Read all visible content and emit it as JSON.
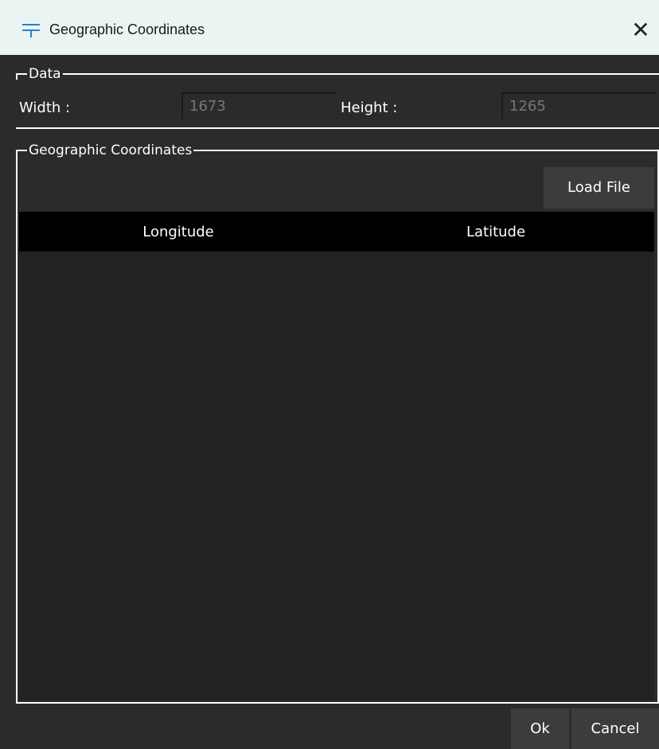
{
  "window": {
    "title": "Geographic Coordinates",
    "close_glyph": "✕",
    "app_icon": "table-icon"
  },
  "data_group": {
    "title": "Data",
    "width_label": "Width :",
    "width_value": "1673",
    "height_label": "Height :",
    "height_value": "1265"
  },
  "coords_group": {
    "title": "Geographic Coordinates",
    "load_file_label": "Load File",
    "columns": [
      "Longitude",
      "Latitude"
    ]
  },
  "footer": {
    "ok_label": "Ok",
    "cancel_label": "Cancel"
  }
}
